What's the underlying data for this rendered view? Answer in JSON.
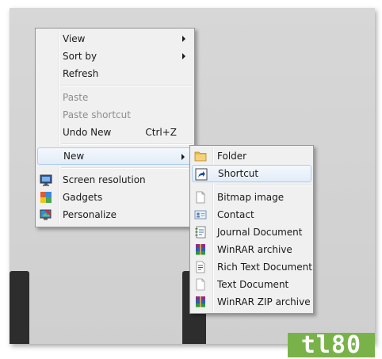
{
  "context_menu": {
    "items": [
      {
        "label": "View",
        "submenu": true
      },
      {
        "label": "Sort by",
        "submenu": true
      },
      {
        "label": "Refresh"
      },
      {
        "label": "Paste",
        "disabled": true
      },
      {
        "label": "Paste shortcut",
        "disabled": true
      },
      {
        "label": "Undo New",
        "shortcut": "Ctrl+Z"
      },
      {
        "label": "New",
        "submenu": true,
        "highlighted": true
      },
      {
        "label": "Screen resolution",
        "icon": "monitor-icon"
      },
      {
        "label": "Gadgets",
        "icon": "gadgets-icon"
      },
      {
        "label": "Personalize",
        "icon": "personalize-icon"
      }
    ]
  },
  "new_submenu": {
    "items": [
      {
        "label": "Folder",
        "icon": "folder-icon"
      },
      {
        "label": "Shortcut",
        "icon": "shortcut-icon",
        "highlighted": true
      },
      {
        "label": "Bitmap image",
        "icon": "bitmap-icon"
      },
      {
        "label": "Contact",
        "icon": "contact-icon"
      },
      {
        "label": "Journal Document",
        "icon": "journal-icon"
      },
      {
        "label": "WinRAR archive",
        "icon": "winrar-icon"
      },
      {
        "label": "Rich Text Document",
        "icon": "rich-text-icon"
      },
      {
        "label": "Text Document",
        "icon": "text-document-icon"
      },
      {
        "label": "WinRAR ZIP archive",
        "icon": "winrar-zip-icon"
      }
    ]
  },
  "watermark": {
    "text": "tl80"
  }
}
